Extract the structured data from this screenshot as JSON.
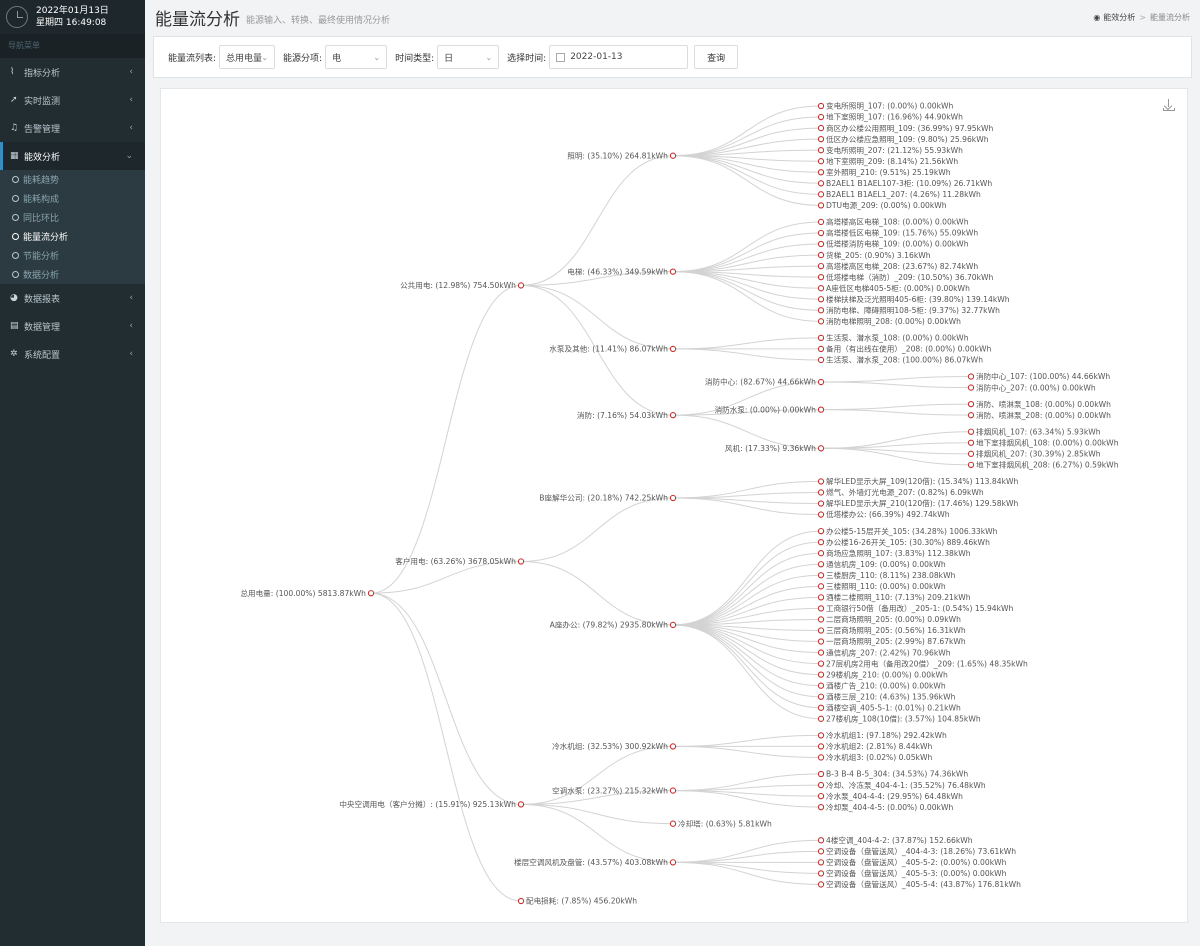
{
  "sidebar": {
    "date": "2022年01月13日",
    "time": "星期四 16:49:08",
    "nav_header": "导航菜单",
    "items": [
      {
        "label": "指标分析",
        "icon": "line-chart-icon",
        "glyph": "⌇",
        "arrow": "‹"
      },
      {
        "label": "实时监测",
        "icon": "send-icon",
        "glyph": "➚",
        "arrow": "‹"
      },
      {
        "label": "告警管理",
        "icon": "bell-icon",
        "glyph": "♫",
        "arrow": "‹"
      },
      {
        "label": "能效分析",
        "icon": "grid-icon",
        "glyph": "▦",
        "arrow": "⌄"
      },
      {
        "label": "数据报表",
        "icon": "pie-chart-icon",
        "glyph": "◕",
        "arrow": "‹"
      },
      {
        "label": "数据管理",
        "icon": "database-icon",
        "glyph": "▤",
        "arrow": "‹"
      },
      {
        "label": "系统配置",
        "icon": "gear-icon",
        "glyph": "✲",
        "arrow": "‹"
      }
    ],
    "sub_items": [
      "能耗趋势",
      "能耗构成",
      "同比环比",
      "能量流分析",
      "节能分析",
      "数据分析"
    ]
  },
  "header": {
    "title": "能量流分析",
    "subtitle": "能源输入、转换、最终使用情况分析",
    "breadcrumb_home": "能效分析",
    "breadcrumb_sep": ">",
    "breadcrumb_current": "能量流分析"
  },
  "filters": {
    "flow_label": "能量流列表:",
    "flow_value": "总用电量",
    "energy_label": "能源分项:",
    "energy_value": "电",
    "time_type_label": "时间类型:",
    "time_type_value": "日",
    "date_label": "选择时间:",
    "date_value": "2022-01-13",
    "query_button": "查询",
    "chevron": "⌄"
  },
  "tree": {
    "name": "总用电量: (100.00%) 5813.87kWh",
    "children": [
      {
        "name": "公共用电: (12.98%) 754.50kWh",
        "children": [
          {
            "name": "照明: (35.10%) 264.81kWh",
            "children": [
              {
                "name": "变电所照明_107: (0.00%) 0.00kWh"
              },
              {
                "name": "地下室照明_107: (16.96%) 44.90kWh"
              },
              {
                "name": "商区办公楼公用照明_109: (36.99%) 97.95kWh"
              },
              {
                "name": "低区办公楼应急照明_109: (9.80%) 25.96kWh"
              },
              {
                "name": "变电所照明_207: (21.12%) 55.93kWh"
              },
              {
                "name": "地下室照明_209: (8.14%) 21.56kWh"
              },
              {
                "name": "室外照明_210: (9.51%) 25.19kWh"
              },
              {
                "name": "B2AEL1 B1AEL107-3柜: (10.09%) 26.71kWh"
              },
              {
                "name": "B2AEL1 B1AEL1_207: (4.26%) 11.28kWh"
              },
              {
                "name": "DTU电源_209: (0.00%) 0.00kWh"
              }
            ]
          },
          {
            "name": "电梯: (46.33%) 349.59kWh",
            "children": [
              {
                "name": "高塔楼高区电梯_108: (0.00%) 0.00kWh"
              },
              {
                "name": "高塔楼低区电梯_109: (15.76%) 55.09kWh"
              },
              {
                "name": "低塔楼消防电梯_109: (0.00%) 0.00kWh"
              },
              {
                "name": "货梯_205: (0.90%) 3.16kWh"
              },
              {
                "name": "高塔楼高区电梯_208: (23.67%) 82.74kWh"
              },
              {
                "name": "低塔楼电梯（消防）_209: (10.50%) 36.70kWh"
              },
              {
                "name": "A座低区电梯405-5柜: (0.00%) 0.00kWh"
              },
              {
                "name": "楼梯扶梯及泛光照明405-6柜: (39.80%) 139.14kWh"
              },
              {
                "name": "消防电梯、障碍照明108-5柜: (9.37%) 32.77kWh"
              },
              {
                "name": "消防电梯照明_208: (0.00%) 0.00kWh"
              }
            ]
          },
          {
            "name": "水泵及其他: (11.41%) 86.07kWh",
            "children": [
              {
                "name": "生活泵、潜水泵_108: (0.00%) 0.00kWh"
              },
              {
                "name": "备用（有出线在使用）_208: (0.00%) 0.00kWh"
              },
              {
                "name": "生活泵、潜水泵_208: (100.00%) 86.07kWh"
              }
            ]
          },
          {
            "name": "消防: (7.16%) 54.03kWh",
            "children": [
              {
                "name": "消防中心: (82.67%) 44.66kWh",
                "children": [
                  {
                    "name": "消防中心_107: (100.00%) 44.66kWh"
                  },
                  {
                    "name": "消防中心_207: (0.00%) 0.00kWh"
                  }
                ]
              },
              {
                "name": "消防水泵: (0.00%) 0.00kWh",
                "children": [
                  {
                    "name": "消防、喷淋泵_108: (0.00%) 0.00kWh"
                  },
                  {
                    "name": "消防、喷淋泵_208: (0.00%) 0.00kWh"
                  }
                ]
              },
              {
                "name": "风机: (17.33%) 9.36kWh",
                "children": [
                  {
                    "name": "排烟风机_107: (63.34%) 5.93kWh"
                  },
                  {
                    "name": "地下室排烟风机_108: (0.00%) 0.00kWh"
                  },
                  {
                    "name": "排烟风机_207: (30.39%) 2.85kWh"
                  },
                  {
                    "name": "地下室排烟风机_208: (6.27%) 0.59kWh"
                  }
                ]
              }
            ]
          }
        ]
      },
      {
        "name": "客户用电: (63.26%) 3678.05kWh",
        "children": [
          {
            "name": "B座解华公司: (20.18%) 742.25kWh",
            "children": [
              {
                "name": "解华LED显示大屏_109(120借): (15.34%) 113.84kWh"
              },
              {
                "name": "燃气、外墙灯光电源_207: (0.82%) 6.09kWh"
              },
              {
                "name": "解华LED显示大屏_210(120借): (17.46%) 129.58kWh"
              },
              {
                "name": "低塔楼办公: (66.39%) 492.74kWh"
              }
            ]
          },
          {
            "name": "A座办公: (79.82%) 2935.80kWh",
            "children": [
              {
                "name": "办公楼5-15层开关_105: (34.28%) 1006.33kWh"
              },
              {
                "name": "办公楼16-26开关_105: (30.30%) 889.46kWh"
              },
              {
                "name": "商场应急照明_107: (3.83%) 112.38kWh"
              },
              {
                "name": "通信机房_109: (0.00%) 0.00kWh"
              },
              {
                "name": "三楼厨房_110: (8.11%) 238.08kWh"
              },
              {
                "name": "三楼照明_110: (0.00%) 0.00kWh"
              },
              {
                "name": "酒楼二楼照明_110: (7.13%) 209.21kWh"
              },
              {
                "name": "工商银行50借（备用改）_205-1: (0.54%) 15.94kWh"
              },
              {
                "name": "二层商场照明_205: (0.00%) 0.09kWh"
              },
              {
                "name": "三层商场照明_205: (0.56%) 16.31kWh"
              },
              {
                "name": "一层商场照明_205: (2.99%) 87.67kWh"
              },
              {
                "name": "通信机房_207: (2.42%) 70.96kWh"
              },
              {
                "name": "27层机房2用电（备用改20借）_209: (1.65%) 48.35kWh"
              },
              {
                "name": "29楼机房_210: (0.00%) 0.00kWh"
              },
              {
                "name": "酒楼广告_210: (0.00%) 0.00kWh"
              },
              {
                "name": "酒楼三层_210: (4.63%) 135.96kWh"
              },
              {
                "name": "酒楼空调_405-5-1: (0.01%) 0.21kWh"
              },
              {
                "name": "27楼机房_108(10借): (3.57%) 104.85kWh"
              }
            ]
          }
        ]
      },
      {
        "name": "中央空调用电（客户分摊）: (15.91%) 925.13kWh",
        "children": [
          {
            "name": "冷水机组: (32.53%) 300.92kWh",
            "children": [
              {
                "name": "冷水机组1: (97.18%) 292.42kWh"
              },
              {
                "name": "冷水机组2: (2.81%) 8.44kWh"
              },
              {
                "name": "冷水机组3: (0.02%) 0.05kWh"
              }
            ]
          },
          {
            "name": "空调水泵: (23.27%) 215.32kWh",
            "children": [
              {
                "name": "B-3 B-4 B-5_304: (34.53%) 74.36kWh"
              },
              {
                "name": "冷却、冷冻泵_404-4-1: (35.52%) 76.48kWh"
              },
              {
                "name": "冷水泵_404-4-4: (29.95%) 64.48kWh"
              },
              {
                "name": "冷却泵_404-4-5: (0.00%) 0.00kWh"
              }
            ]
          },
          {
            "name": "冷却塔: (0.63%) 5.81kWh"
          },
          {
            "name": "楼层空调风机及盘管: (43.57%) 403.08kWh",
            "children": [
              {
                "name": "4楼空调_404-4-2: (37.87%) 152.66kWh"
              },
              {
                "name": "空调设备（盘管送风）_404-4-3: (18.26%) 73.61kWh"
              },
              {
                "name": "空调设备（盘管送风）_405-5-2: (0.00%) 0.00kWh"
              },
              {
                "name": "空调设备（盘管送风）_405-5-3: (0.00%) 0.00kWh"
              },
              {
                "name": "空调设备（盘管送风）_405-5-4: (43.87%) 176.81kWh"
              }
            ]
          }
        ]
      },
      {
        "name": "配电损耗: (7.85%) 456.20kWh"
      }
    ]
  }
}
